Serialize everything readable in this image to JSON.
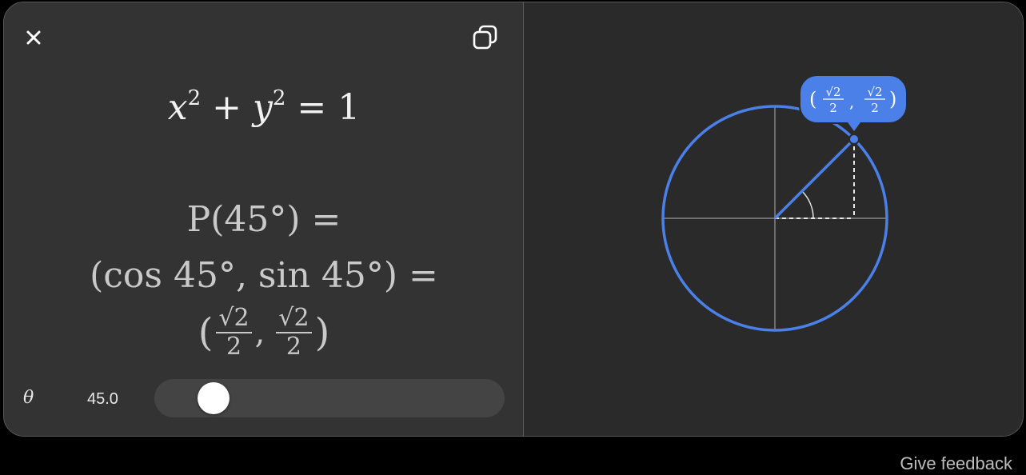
{
  "header": {
    "close_icon": "close-icon",
    "copy_icon": "copy-icon"
  },
  "equations": {
    "circle_lhs_x": "x",
    "circle_exp_x": "2",
    "circle_plus": " + ",
    "circle_lhs_y": "y",
    "circle_exp_y": "2",
    "circle_rhs": " = 1",
    "point_line1": "P(45°) =",
    "point_line2": "(cos 45°, sin 45°) =",
    "frac_num": "√2",
    "frac_den": "2",
    "paren_open": "(",
    "paren_close": ")",
    "comma": ","
  },
  "slider": {
    "variable": "θ",
    "value_text": "45.0",
    "value": 45.0,
    "min": 0,
    "max": 360,
    "fraction": 0.125
  },
  "graph": {
    "angle_deg": 45,
    "circle_color": "#4a80e8",
    "axis_color": "#9a9a9a",
    "label_bg": "#4a80e8",
    "label_num": "√2",
    "label_den": "2",
    "label_paren_open": "(",
    "label_paren_close": ")",
    "label_comma": ","
  },
  "footer": {
    "feedback": "Give feedback"
  }
}
